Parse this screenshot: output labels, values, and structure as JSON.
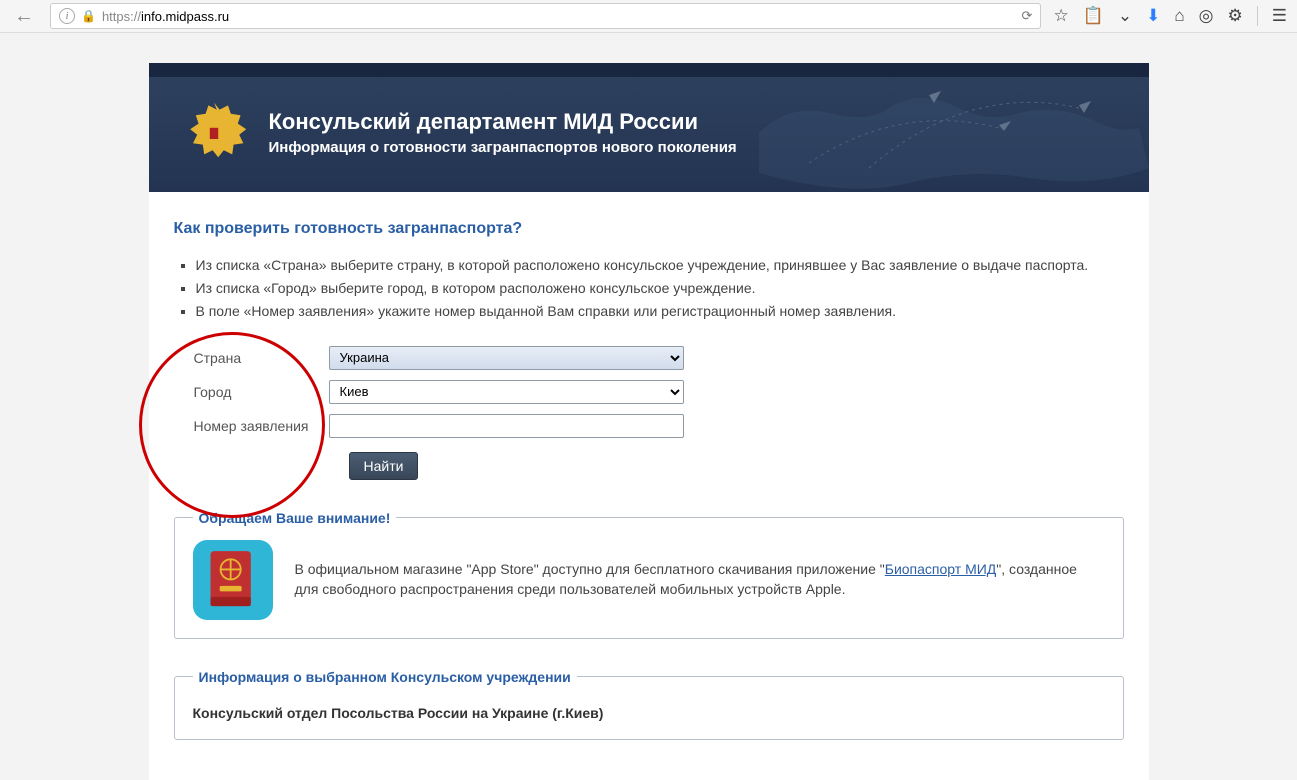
{
  "browser": {
    "url_prefix": "https://",
    "url_host": "info.midpass.ru",
    "icons": {
      "back": "back-icon",
      "info": "info-icon",
      "lock": "lock-icon",
      "reload": "reload-icon",
      "star": "star-icon",
      "clipboard": "clipboard-icon",
      "pocket": "pocket-icon",
      "download": "download-icon",
      "home": "home-icon",
      "onion": "onion-icon",
      "bug": "bug-icon",
      "menu": "menu-icon"
    }
  },
  "header": {
    "title": "Консульский департамент МИД России",
    "subtitle": "Информация о готовности загранпаспортов нового поколения"
  },
  "question": "Как проверить готовность загранпаспорта?",
  "instructions": [
    "Из списка «Страна» выберите страну, в которой расположено консульское учреждение, принявшее у Вас заявление о выдаче паспорта.",
    "Из списка «Город» выберите город, в котором расположено консульское учреждение.",
    "В поле «Номер заявления» укажите номер выданной Вам справки или регистрационный номер заявления."
  ],
  "form": {
    "country_label": "Страна",
    "country_value": "Украина",
    "city_label": "Город",
    "city_value": "Киев",
    "number_label": "Номер заявления",
    "number_value": "",
    "submit_label": "Найти"
  },
  "notice": {
    "legend": "Обращаем Ваше внимание!",
    "text_before": "В официальном магазине \"App Store\" доступно для бесплатного скачивания приложение \"",
    "link_label": "Биопаспорт МИД",
    "text_after": "\", созданное для свободного распространения среди пользователей мобильных устройств Apple."
  },
  "consulate": {
    "legend": "Информация о выбранном Консульском учреждении",
    "name": "Консульский отдел Посольства России на Украине (г.Киев)"
  }
}
